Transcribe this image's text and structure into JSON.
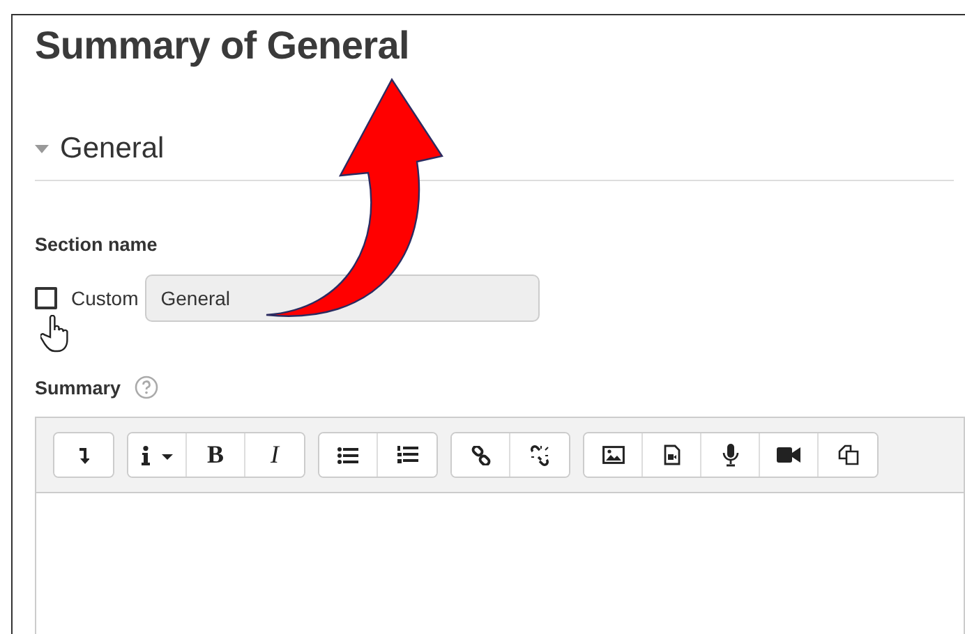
{
  "page_title": "Summary of General",
  "section": {
    "title": "General",
    "expanded": true
  },
  "section_name": {
    "label": "Section name",
    "custom_label": "Custom",
    "custom_checked": false,
    "value": "General"
  },
  "summary": {
    "label": "Summary"
  },
  "toolbar": [
    {
      "buttons": [
        {
          "kind": "collapse"
        }
      ]
    },
    {
      "buttons": [
        {
          "kind": "info-menu"
        },
        {
          "kind": "bold",
          "label": "B"
        },
        {
          "kind": "italic",
          "label": "I"
        }
      ]
    },
    {
      "buttons": [
        {
          "kind": "bullets"
        },
        {
          "kind": "numbers"
        }
      ]
    },
    {
      "buttons": [
        {
          "kind": "link"
        },
        {
          "kind": "unlink"
        }
      ]
    },
    {
      "buttons": [
        {
          "kind": "image"
        },
        {
          "kind": "media"
        },
        {
          "kind": "mic"
        },
        {
          "kind": "video"
        },
        {
          "kind": "copy"
        }
      ]
    }
  ]
}
